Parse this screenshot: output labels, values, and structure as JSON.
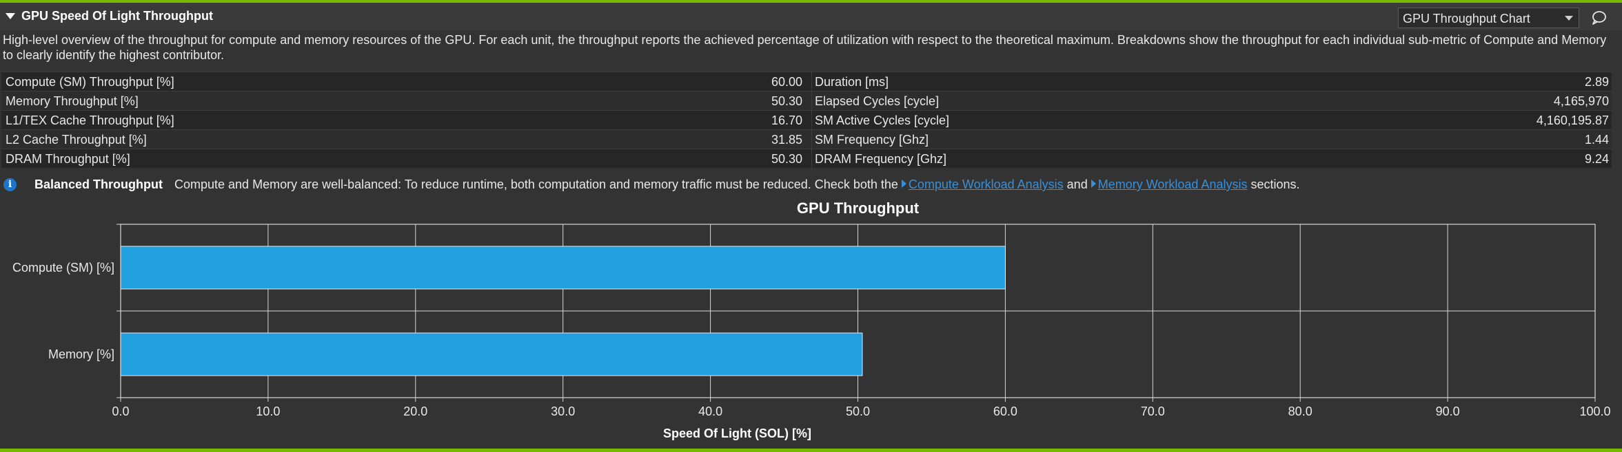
{
  "section": {
    "title": "GPU Speed Of Light Throughput",
    "dropdown_value": "GPU Throughput Chart",
    "description": "High-level overview of the throughput for compute and memory resources of the GPU. For each unit, the throughput reports the achieved percentage of utilization with respect to the theoretical maximum. Breakdowns show the throughput for each individual sub-metric of Compute and Memory to clearly identify the highest contributor."
  },
  "metrics": [
    {
      "left_label": "Compute (SM) Throughput [%]",
      "left_value": "60.00",
      "right_label": "Duration [ms]",
      "right_value": "2.89"
    },
    {
      "left_label": "Memory Throughput [%]",
      "left_value": "50.30",
      "right_label": "Elapsed Cycles [cycle]",
      "right_value": "4,165,970"
    },
    {
      "left_label": "L1/TEX Cache Throughput [%]",
      "left_value": "16.70",
      "right_label": "SM Active Cycles [cycle]",
      "right_value": "4,160,195.87"
    },
    {
      "left_label": "L2 Cache Throughput [%]",
      "left_value": "31.85",
      "right_label": "SM Frequency [Ghz]",
      "right_value": "1.44"
    },
    {
      "left_label": "DRAM Throughput [%]",
      "left_value": "50.30",
      "right_label": "DRAM Frequency [Ghz]",
      "right_value": "9.24"
    }
  ],
  "rule": {
    "icon": "info-icon",
    "name": "Balanced Throughput",
    "text_before": "Compute and Memory are well-balanced: To reduce runtime, both computation and memory traffic must be reduced. Check both the ",
    "link1": "Compute Workload Analysis",
    "text_middle": " and ",
    "link2": "Memory Workload Analysis",
    "text_after": " sections."
  },
  "colors": {
    "accent": "#76b900",
    "bar": "#229fde",
    "link": "#3a8fd9",
    "info": "#1f74c8"
  },
  "chart_data": {
    "type": "bar",
    "orientation": "horizontal",
    "title": "GPU Throughput",
    "xlabel": "Speed Of Light (SOL) [%]",
    "ylabel": "",
    "categories": [
      "Compute (SM) [%]",
      "Memory [%]"
    ],
    "values": [
      60.0,
      50.3
    ],
    "xlim": [
      0,
      100
    ],
    "xticks": [
      "0.0",
      "10.0",
      "20.0",
      "30.0",
      "40.0",
      "50.0",
      "60.0",
      "70.0",
      "80.0",
      "90.0",
      "100.0"
    ],
    "grid": true,
    "legend": "none"
  }
}
